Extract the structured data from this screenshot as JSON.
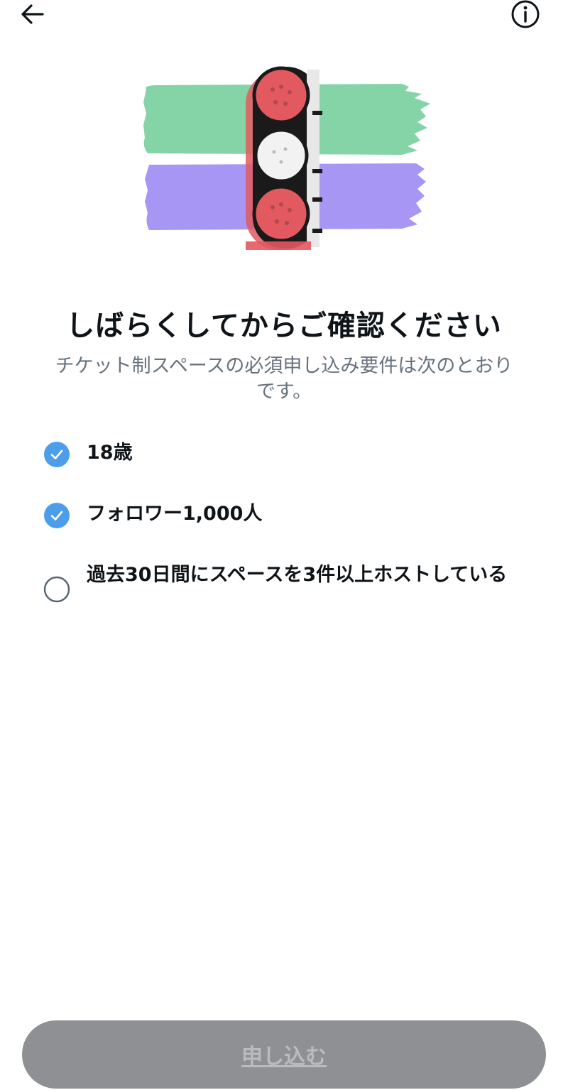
{
  "header": {
    "back_icon": "arrow-left-icon",
    "info_icon": "info-circle-icon"
  },
  "illustration": {
    "icon": "traffic-light-illustration",
    "colors": {
      "green": "#84d4a8",
      "purple": "#a796f3",
      "light_red": "#e2595f",
      "frame": "#1a1a1a"
    }
  },
  "title": "しばらくしてからご確認ください",
  "subtitle": "チケット制スペースの必須申し込み要件は次のとおりです。",
  "requirements": [
    {
      "label": "18歳",
      "met": true
    },
    {
      "label": "フォロワー1,000人",
      "met": true
    },
    {
      "label": "過去30日間にスペースを3件以上ホストしている",
      "met": false
    }
  ],
  "apply_button": {
    "label": "申し込む",
    "enabled": false
  },
  "colors": {
    "check_blue": "#4c9eeb",
    "text_primary": "#0f1419",
    "text_secondary": "#66737f",
    "button_disabled": "#8e9093"
  }
}
